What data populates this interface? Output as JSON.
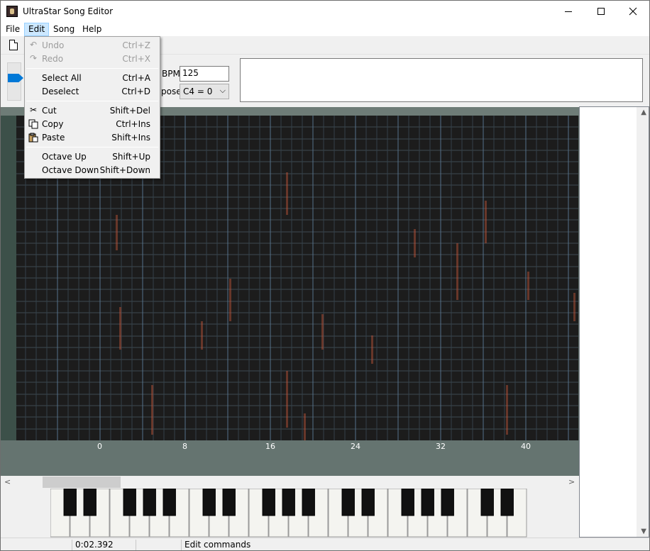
{
  "window": {
    "title": "UltraStar Song Editor",
    "icons": {
      "app": "ultrastar-app-icon",
      "minimize": "minimize-icon",
      "maximize": "maximize-icon",
      "close": "close-icon"
    }
  },
  "menubar": {
    "items": [
      {
        "label": "File"
      },
      {
        "label": "Edit",
        "active": true
      },
      {
        "label": "Song"
      },
      {
        "label": "Help"
      }
    ]
  },
  "edit_menu": {
    "items": [
      {
        "label": "Undo",
        "shortcut": "Ctrl+Z",
        "icon": "undo-icon",
        "enabled": false
      },
      {
        "label": "Redo",
        "shortcut": "Ctrl+X",
        "icon": "redo-icon",
        "enabled": false
      },
      {
        "label": "Select All",
        "shortcut": "Ctrl+A",
        "icon": "",
        "enabled": true
      },
      {
        "label": "Deselect",
        "shortcut": "Ctrl+D",
        "icon": "",
        "enabled": true
      },
      {
        "label": "Cut",
        "shortcut": "Shift+Del",
        "icon": "scissors-icon",
        "enabled": true
      },
      {
        "label": "Copy",
        "shortcut": "Ctrl+Ins",
        "icon": "copy-icon",
        "enabled": true
      },
      {
        "label": "Paste",
        "shortcut": "Shift+Ins",
        "icon": "paste-icon",
        "enabled": true
      },
      {
        "label": "Octave Up",
        "shortcut": "Shift+Up",
        "icon": "",
        "enabled": true
      },
      {
        "label": "Octave Down",
        "shortcut": "Shift+Down",
        "icon": "",
        "enabled": true
      }
    ]
  },
  "toolbar": {
    "new_icon": "new-document-icon"
  },
  "controls": {
    "bpm_label": "BPM:",
    "bpm_value": "125",
    "transpose_label": "pose:",
    "transpose_value": "C4 = 0",
    "lyrics_text": ""
  },
  "editor": {
    "beat_ticks": [
      "0",
      "8",
      "16",
      "24",
      "32",
      "40"
    ],
    "colors": {
      "grid_bg": "#1c1c1c",
      "band": "#5a6863",
      "spectral": "#c4573a"
    }
  },
  "piano": {
    "white_key_count": 24
  },
  "statusbar": {
    "time": "0:02.392",
    "message": "Edit commands"
  }
}
